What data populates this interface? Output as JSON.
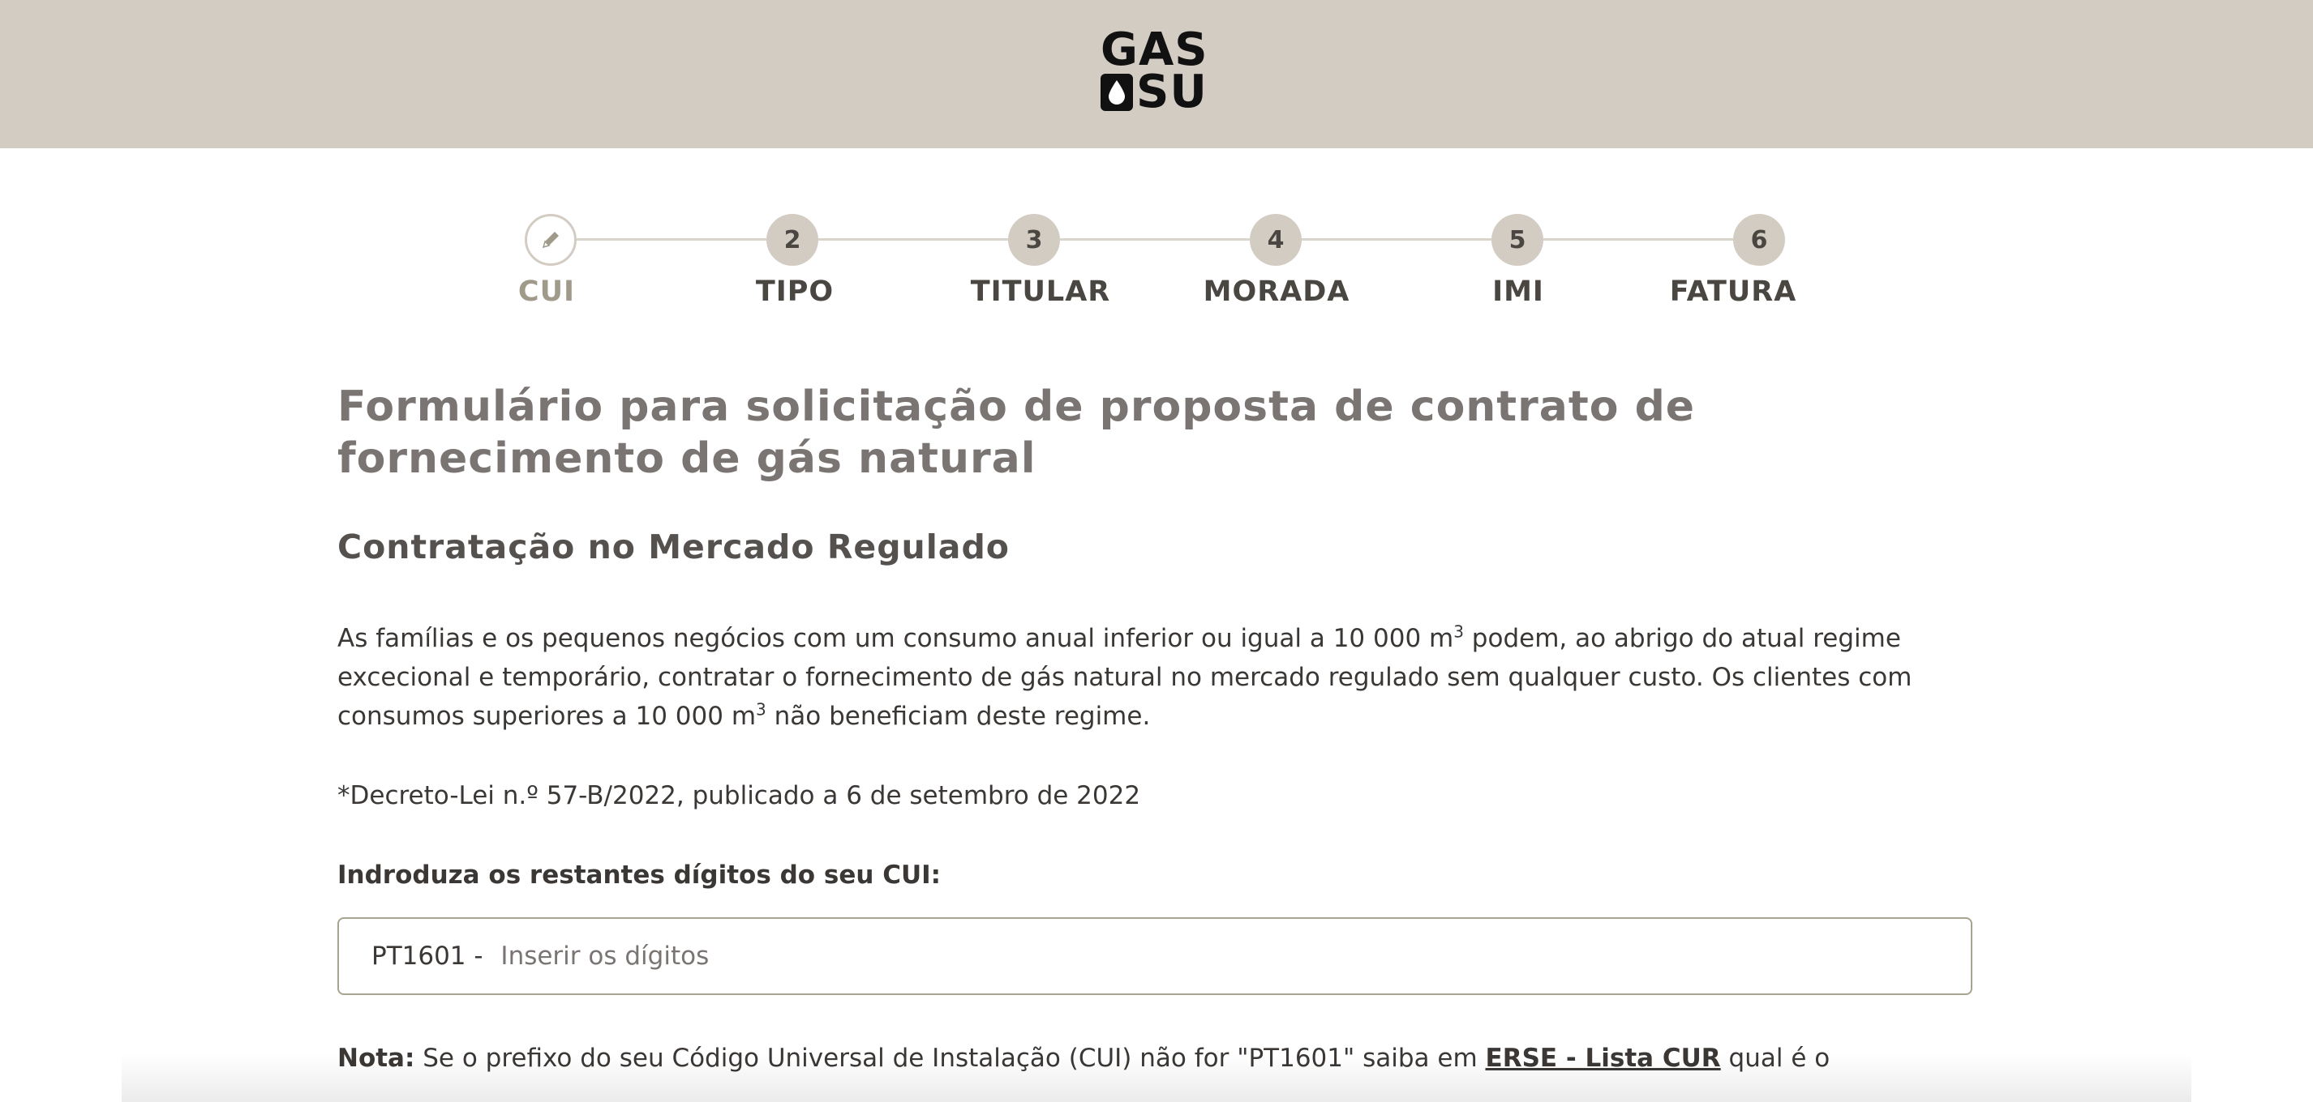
{
  "header": {
    "logo_line1": "GAS",
    "logo_line2": "SU"
  },
  "stepper": {
    "steps": [
      {
        "number": "",
        "label": "CUI",
        "active": true
      },
      {
        "number": "2",
        "label": "TIPO",
        "active": false
      },
      {
        "number": "3",
        "label": "TITULAR",
        "active": false
      },
      {
        "number": "4",
        "label": "MORADA",
        "active": false
      },
      {
        "number": "5",
        "label": "IMI",
        "active": false
      },
      {
        "number": "6",
        "label": "FATURA",
        "active": false
      }
    ]
  },
  "main": {
    "title": "Formulário para solicitação de proposta de contrato de fornecimento de gás natural",
    "subtitle": "Contratação no Mercado Regulado",
    "paragraph_part1": "As famílias e os pequenos negócios com um consumo anual inferior ou igual a 10 000 m",
    "paragraph_sup1": "3",
    "paragraph_part2": " podem, ao abrigo do atual regime excecional e temporário, contratar o fornecimento de gás natural no mercado regulado sem qualquer custo. Os clientes com consumos superiores a 10 000 m",
    "paragraph_sup2": "3",
    "paragraph_part3": " não beneficiam deste regime.",
    "decree": "*Decreto-Lei n.º 57-B/2022, publicado a 6 de setembro de 2022",
    "cui_label": "Indroduza os restantes dígitos do seu CUI:",
    "cui_prefix": "PT1601 - ",
    "cui_placeholder": "Inserir os dígitos",
    "cui_value": "",
    "note_label": "Nota:",
    "note_text": " Se o prefixo do seu Código Universal de Instalação (CUI) não for \"PT1601\" saiba em ",
    "note_link": "ERSE - Lista CUR",
    "note_text_end": " qual é o"
  },
  "colors": {
    "header_bg": "#d3ccc3",
    "step_active_label": "#a09a8a",
    "title": "#7a7573",
    "input_border": "#a8a492"
  },
  "icons": {
    "step1_icon": "pencil-icon",
    "logo_icon": "drop-icon"
  }
}
